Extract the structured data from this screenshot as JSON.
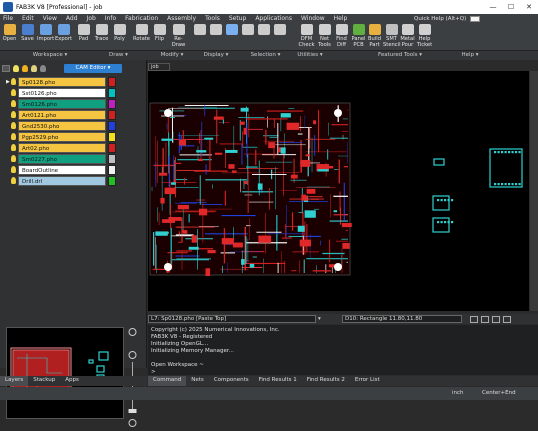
{
  "window": {
    "title": "FAB3K V8 [Professional] - job"
  },
  "menu": [
    "File",
    "Edit",
    "View",
    "Add",
    "Job",
    "Info",
    "Fabrication",
    "Assembly",
    "Tools",
    "Setup",
    "Applications",
    "Window",
    "Help"
  ],
  "quick_help": "Quick Help (Alt+Q)",
  "toolbar": {
    "buttons": [
      {
        "label": "Open",
        "icon": "folder-icon",
        "color": "#e8b040"
      },
      {
        "label": "Save",
        "icon": "save-icon",
        "color": "#4a7fd0"
      },
      {
        "label": "Import",
        "icon": "import-icon",
        "color": "#6aa0e0"
      },
      {
        "label": "Export",
        "icon": "export-icon",
        "color": "#6aa0e0"
      },
      {
        "label": "Pad",
        "icon": "pad-icon",
        "color": "#cccccc"
      },
      {
        "label": "Trace",
        "icon": "trace-icon",
        "color": "#cccccc"
      },
      {
        "label": "Poly",
        "icon": "poly-icon",
        "color": "#cccccc"
      },
      {
        "label": "Rotate",
        "icon": "rotate-icon",
        "color": "#cccccc"
      },
      {
        "label": "Flip",
        "icon": "flip-icon",
        "color": "#cccccc"
      },
      {
        "label": "Re-Draw",
        "icon": "redraw-icon",
        "color": "#cccccc"
      },
      {
        "label": "",
        "icon": "zoom-in-icon",
        "color": "#cccccc"
      },
      {
        "label": "",
        "icon": "zoom-out-icon",
        "color": "#cccccc"
      },
      {
        "label": "",
        "icon": "selection-icon",
        "color": "#7ab0f0"
      },
      {
        "label": "",
        "icon": "grid-icon",
        "color": "#cccccc"
      },
      {
        "label": "",
        "icon": "cursor-icon",
        "color": "#cccccc"
      },
      {
        "label": "",
        "icon": "measure-icon",
        "color": "#cccccc"
      },
      {
        "label": "DFM Check",
        "icon": "dfm-icon",
        "color": "#d0d0d0"
      },
      {
        "label": "Net Tools",
        "icon": "net-icon",
        "color": "#d0d0d0"
      },
      {
        "label": "Find Diff",
        "icon": "find-diff-icon",
        "color": "#d0d0d0"
      },
      {
        "label": "Panel PCB",
        "icon": "panel-icon",
        "color": "#60b040"
      },
      {
        "label": "Build Part",
        "icon": "build-part-icon",
        "color": "#e8b040"
      },
      {
        "label": "SMT Stencil",
        "icon": "stencil-icon",
        "color": "#c0c0c0"
      },
      {
        "label": "Metal Pour",
        "icon": "pour-icon",
        "color": "#d0d0d0"
      },
      {
        "label": "Help Ticket",
        "icon": "help-ticket-icon",
        "color": "#d0d0d0"
      }
    ]
  },
  "groups": [
    "Workspace",
    "Draw",
    "Modify",
    "Display",
    "Selection",
    "Utilities",
    "Featured Tools",
    "Help"
  ],
  "left_panel": {
    "cam_editor": "CAM Editor",
    "layers": [
      {
        "name": "Sp0128.pho",
        "bg": "#f5c542",
        "color": "#d02020"
      },
      {
        "name": "Sst0126.pho",
        "bg": "#ffffff",
        "color": "#00c0c0"
      },
      {
        "name": "Sm0126.pho",
        "bg": "#10a080",
        "color": "#c020c0"
      },
      {
        "name": "Art0121.pho",
        "bg": "#f5c542",
        "color": "#d02020"
      },
      {
        "name": "Gnd2530.pho",
        "bg": "#f5c542",
        "color": "#2040e0"
      },
      {
        "name": "Pgp2529.pho",
        "bg": "#f5c542",
        "color": "#f0e020"
      },
      {
        "name": "Art02.pho",
        "bg": "#f5c542",
        "color": "#d02020"
      },
      {
        "name": "Sm0227.pho",
        "bg": "#10a080",
        "color": "#c0c0c0"
      },
      {
        "name": "BoardOutline",
        "bg": "#ffffff",
        "color": "#f0f0f0"
      },
      {
        "name": "Drill.drl",
        "bg": "#a0c8e0",
        "color": "#20c020"
      }
    ],
    "tabs": [
      "Layers",
      "Stackup",
      "Apps"
    ]
  },
  "canvas_tab": "job",
  "status": {
    "layer_select": "L7: Sp0128.pho  [Paste Top]",
    "dcode_select": "D10: Rectangle 11.80,11.80"
  },
  "console": {
    "lines": [
      "Copyright (c) 2025  Numerical Innovations, Inc.",
      "FAB3K V8 - Registered",
      "Initializing OpenGL...",
      "Initializing Memory Manager...",
      "",
      "Open Workspace ~",
      ">"
    ]
  },
  "bottom_tabs": [
    "Command",
    "Nets",
    "Components",
    "Find Results 1",
    "Find Results 2",
    "Error List"
  ],
  "statusbar": {
    "units": "inch",
    "snap": "Center+End"
  }
}
